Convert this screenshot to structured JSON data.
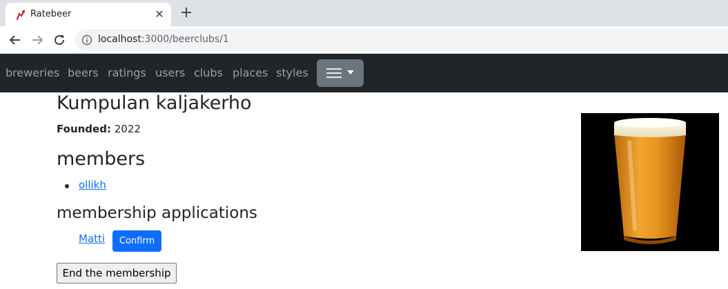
{
  "browser": {
    "tab_title": "Ratebeer",
    "url_host": "localhost",
    "url_path": ":3000/beerclubs/1"
  },
  "nav": {
    "links": [
      "breweries",
      "beers",
      "ratings",
      "users",
      "clubs",
      "places",
      "styles"
    ]
  },
  "club": {
    "name": "Kumpulan kaljakerho",
    "founded_label": "Founded:",
    "founded_year": "2022"
  },
  "members": {
    "heading": "members",
    "items": [
      "ollikh"
    ]
  },
  "applications": {
    "heading": "membership applications",
    "applicant": "Matti",
    "confirm_label": "Confirm"
  },
  "actions": {
    "end_membership_label": "End the membership"
  },
  "colors": {
    "navbar": "#212529",
    "link": "#0d6efd",
    "primary_button": "#0d6efd",
    "dropdown_button": "#6c757d"
  }
}
